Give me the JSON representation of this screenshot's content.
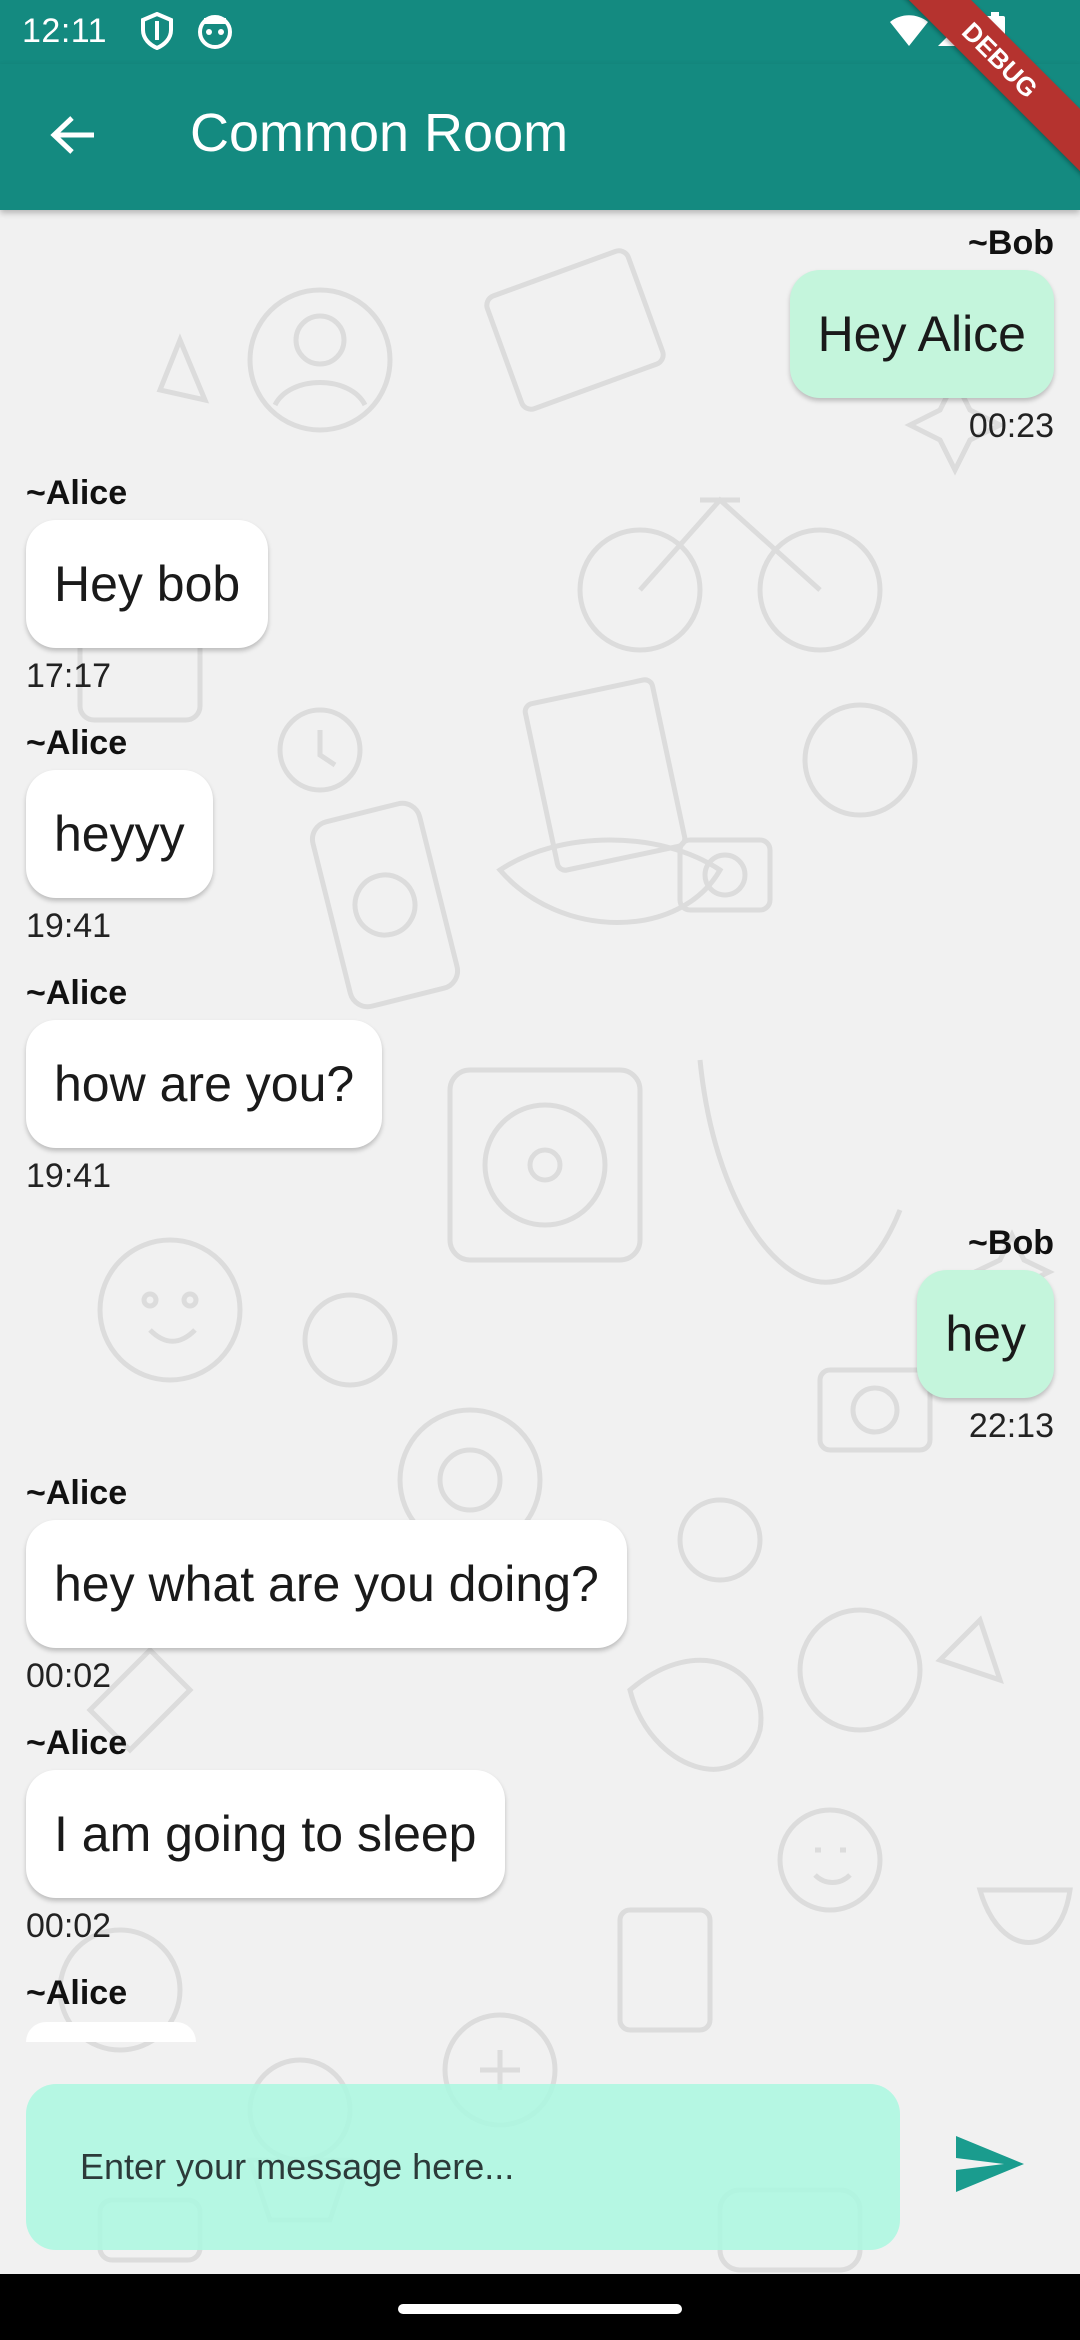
{
  "status_bar": {
    "time": "12:11",
    "icons": [
      "shield-icon",
      "android-icon",
      "wifi-icon",
      "signal-icon",
      "battery-icon"
    ]
  },
  "debug_banner": "DEBUG",
  "app_bar": {
    "title": "Common Room",
    "back_icon": "arrow-back-icon",
    "color": "#148a80"
  },
  "messages": [
    {
      "sender": "~Bob",
      "text": "Hey Alice",
      "time": "00:23",
      "side": "right"
    },
    {
      "sender": "~Alice",
      "text": "Hey bob",
      "time": "17:17",
      "side": "left"
    },
    {
      "sender": "~Alice",
      "text": "heyyy",
      "time": "19:41",
      "side": "left"
    },
    {
      "sender": "~Alice",
      "text": "how are you?",
      "time": "19:41",
      "side": "left"
    },
    {
      "sender": "~Bob",
      "text": "hey",
      "time": "22:13",
      "side": "right"
    },
    {
      "sender": "~Alice",
      "text": "hey what are you doing?",
      "time": "00:02",
      "side": "left"
    },
    {
      "sender": "~Alice",
      "text": "I am going to sleep",
      "time": "00:02",
      "side": "left"
    },
    {
      "sender": "~Alice",
      "text": "",
      "time": "",
      "side": "left"
    }
  ],
  "composer": {
    "placeholder": "Enter your message here...",
    "value": "",
    "send_icon": "send-icon",
    "accent": "#1a9c8e"
  },
  "colors": {
    "incoming_bubble": "#ffffff",
    "outgoing_bubble": "#c4f5dc",
    "input_background": "#aaf8e1"
  }
}
